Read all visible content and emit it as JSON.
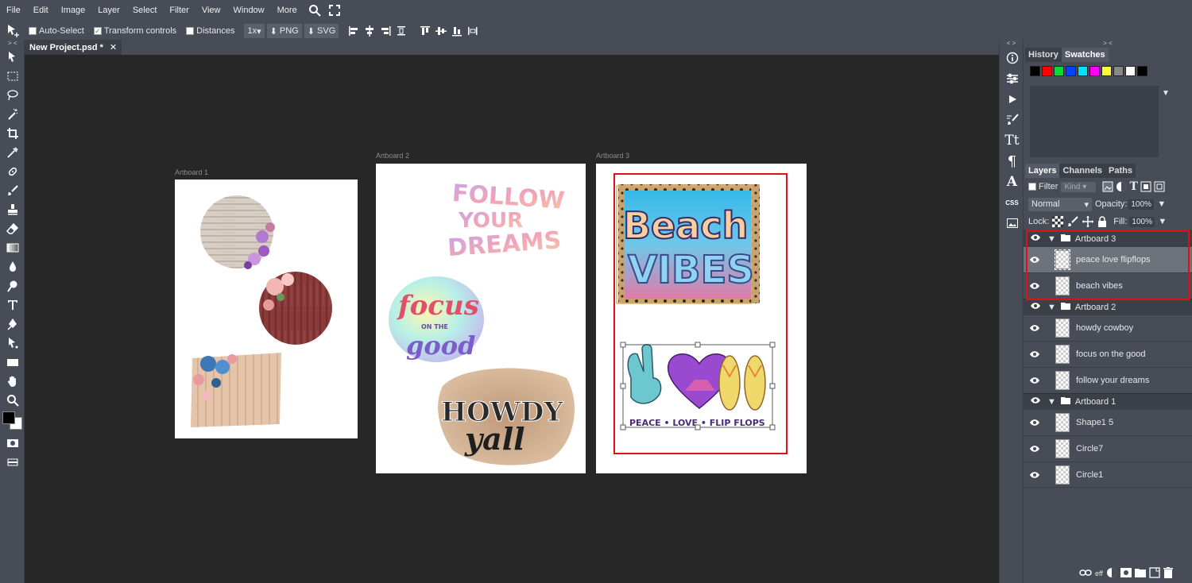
{
  "menu": [
    "File",
    "Edit",
    "Image",
    "Layer",
    "Select",
    "Filter",
    "View",
    "Window",
    "More"
  ],
  "options": {
    "auto_select": "Auto-Select",
    "transform_controls": "Transform controls",
    "distances": "Distances",
    "scale": "1x",
    "png": "PNG",
    "svg": "SVG"
  },
  "document": {
    "tab_title": "New Project.psd *",
    "close": "✕"
  },
  "artboards": [
    {
      "label": "Artboard 1"
    },
    {
      "label": "Artboard 2"
    },
    {
      "label": "Artboard 3"
    }
  ],
  "artwork_text": {
    "follow": "FOLLOW",
    "your": "YOUR",
    "dreams": "DREAMS",
    "focus": "focus",
    "on_the": "ON THE",
    "good": "good",
    "howdy": "HOWDY",
    "yall": "yall",
    "beach": "Beach",
    "vibes": "VIBES",
    "plf": "PEACE • LOVE • FLIP FLOPS"
  },
  "side_strip": {
    "css": "CSS",
    "collapse": "< >"
  },
  "right_panel": {
    "collapse": "> <",
    "top_tabs": [
      "History",
      "Swatches"
    ],
    "swatch_colors": [
      "#000000",
      "#ff0000",
      "#00dd33",
      "#0044ff",
      "#00e0ff",
      "#ff00ff",
      "#ffff33",
      "#888888",
      "#ffffff",
      "#000000"
    ],
    "layer_tabs": [
      "Layers",
      "Channels",
      "Paths"
    ],
    "filter_label": "Filter",
    "kind_label": "Kind",
    "blend_mode": "Normal",
    "opacity_label": "Opacity:",
    "opacity_value": "100%",
    "lock_label": "Lock:",
    "fill_label": "Fill:",
    "fill_value": "100%",
    "bottom_eff": "eff"
  },
  "layers": {
    "group3": "Artboard 3",
    "g3_items": [
      "peace love flipflops",
      "beach vibes"
    ],
    "group2": "Artboard 2",
    "g2_items": [
      "howdy cowboy",
      "focus on the good",
      "follow your dreams"
    ],
    "group1": "Artboard 1",
    "g1_items": [
      "Shape1 5",
      "Circle7",
      "Circle1"
    ]
  }
}
